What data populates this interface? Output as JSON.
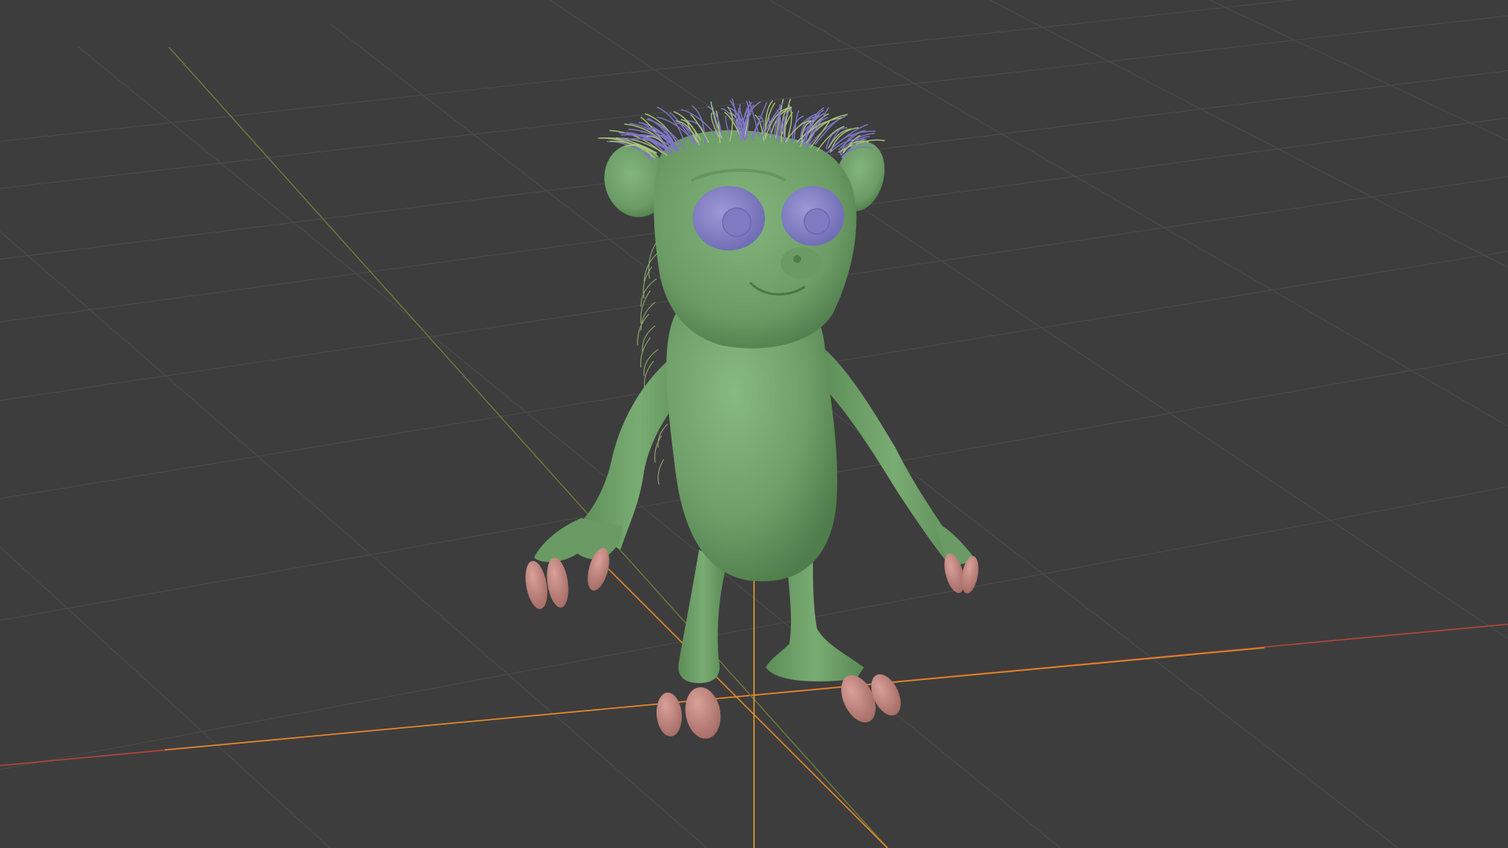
{
  "viewport": {
    "background": "#3d3d3d",
    "grid_color": "#4a4a4a",
    "x_axis_color": "#c8463a",
    "x_axis_highlight": "#e08a2a",
    "y_axis_color": "#7a8a3a",
    "origin_color": "#e39a2a"
  },
  "character": {
    "body_color": "#73a46e",
    "body_shadow": "#5a8a56",
    "eye_color": "#8a86c8",
    "hair_color": "#8076c4",
    "fur_color": "#a6c47a",
    "claw_color": "#c98a84"
  }
}
